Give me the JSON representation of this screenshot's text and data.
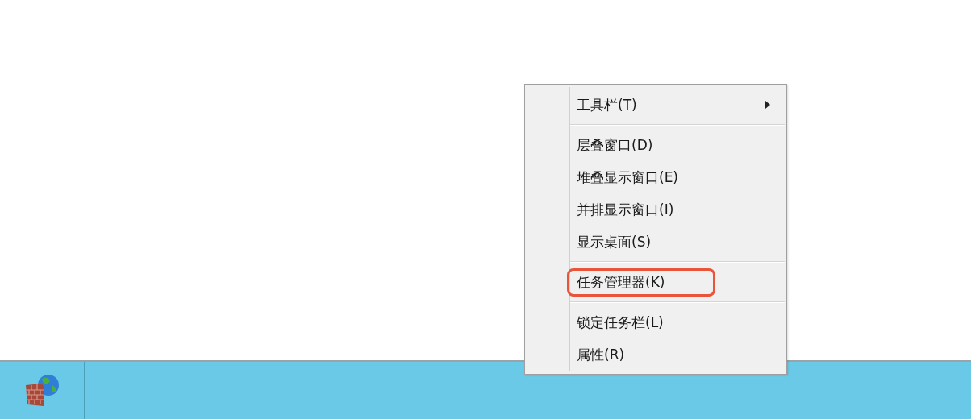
{
  "context_menu": {
    "items": [
      {
        "kind": "item",
        "label": "工具栏(T)",
        "submenu": true,
        "highlighted": false
      },
      {
        "kind": "separator"
      },
      {
        "kind": "item",
        "label": "层叠窗口(D)",
        "submenu": false,
        "highlighted": false
      },
      {
        "kind": "item",
        "label": "堆叠显示窗口(E)",
        "submenu": false,
        "highlighted": false
      },
      {
        "kind": "item",
        "label": "并排显示窗口(I)",
        "submenu": false,
        "highlighted": false
      },
      {
        "kind": "item",
        "label": "显示桌面(S)",
        "submenu": false,
        "highlighted": false
      },
      {
        "kind": "separator"
      },
      {
        "kind": "item",
        "label": "任务管理器(K)",
        "submenu": false,
        "highlighted": true
      },
      {
        "kind": "separator"
      },
      {
        "kind": "item",
        "label": "锁定任务栏(L)",
        "submenu": false,
        "highlighted": false
      },
      {
        "kind": "item",
        "label": "属性(R)",
        "submenu": false,
        "highlighted": false
      }
    ]
  }
}
